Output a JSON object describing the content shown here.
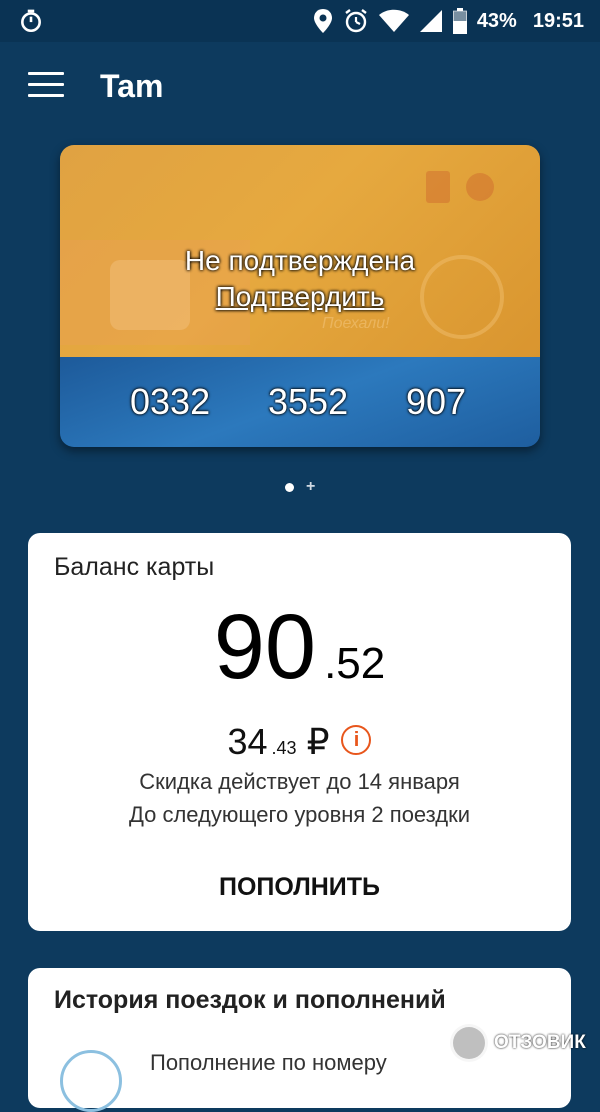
{
  "status_bar": {
    "battery": "43%",
    "time": "19:51"
  },
  "app_bar": {
    "title": "Tam"
  },
  "card": {
    "status": "Не подтверждена",
    "confirm_link": "Подтвердить",
    "slogan": "Поехали!",
    "number_parts": [
      "0332",
      "3552",
      "907"
    ]
  },
  "balance": {
    "title": "Баланс карты",
    "integer": "90",
    "fraction": ".52",
    "fare_integer": "34",
    "fare_fraction": ".43",
    "currency": "₽",
    "discount_note": "Скидка действует до 14 января",
    "next_level_note": "До следующего уровня 2 поездки",
    "topup_button": "ПОПОЛНИТЬ"
  },
  "history": {
    "title": "История поездок и пополнений",
    "first_item": "Пополнение по номеру"
  },
  "watermark": {
    "text": "ОТЗОВИК"
  },
  "colors": {
    "background": "#0d3a5e",
    "card_orange": "#e0a242",
    "card_blue": "#1d5a9a",
    "info_accent": "#e8561c"
  }
}
